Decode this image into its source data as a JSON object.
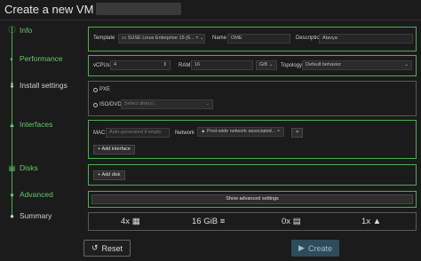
{
  "header": {
    "title": "Create a new VM on"
  },
  "nav": {
    "info": "Info",
    "performance": "Performance",
    "install_settings": "Install settings",
    "interfaces": "Interfaces",
    "disks": "Disks",
    "advanced": "Advanced",
    "summary": "Summary"
  },
  "info": {
    "template_label": "Template",
    "template_value": "SUSE Linux Enterprise 15 (6...",
    "template_clear": "×",
    "template_chevron": "⌄",
    "name_label": "Name",
    "name_value": "OME",
    "description_label": "Description",
    "description_value": "Atavya"
  },
  "performance": {
    "vcpus_label": "vCPUs",
    "vcpus_value": "4",
    "ram_label": "RAM",
    "ram_value": "16",
    "ram_unit": "GiB",
    "topology_label": "Topology",
    "topology_value": "Default behavior"
  },
  "install": {
    "pxe_label": "PXE",
    "iso_label": "ISO/DVD",
    "iso_placeholder": "Select disk(s)..."
  },
  "interfaces": {
    "mac_label": "MAC",
    "mac_placeholder": "Auto-generated if empty",
    "network_label": "Network",
    "network_value": "Pool-wide network associated...",
    "network_clear": "×",
    "remove_label": "×",
    "add_label": "Add interface"
  },
  "disks": {
    "add_label": "Add disk"
  },
  "advanced": {
    "show_label": "Show advanced settings"
  },
  "summary": {
    "cpus": "4x",
    "ram": "16 GiB",
    "disks": "0x",
    "interfaces": "1x"
  },
  "actions": {
    "reset": "Reset",
    "create": "Create"
  },
  "colors": {
    "accent": "#4caf50",
    "create_bg": "#2d4b5a"
  }
}
